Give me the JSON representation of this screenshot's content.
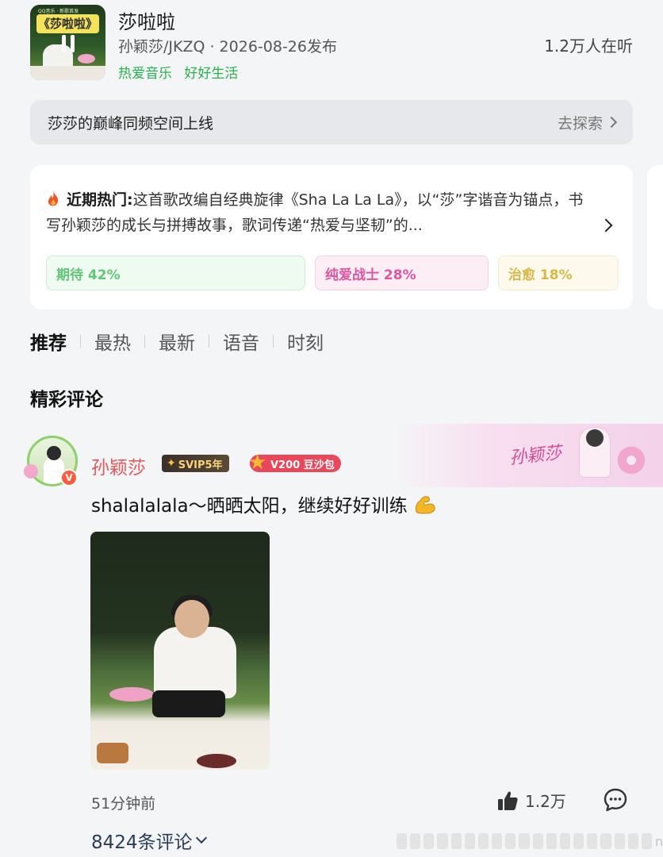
{
  "song": {
    "cover_title": "《莎啦啦》",
    "cover_tag": "QQ音乐 · 新歌首发",
    "title": "莎啦啦",
    "meta": "孙颖莎/JKZQ · 2026-08-26发布",
    "tags": [
      "热爱音乐",
      "好好生活"
    ],
    "listeners": "1.2万人在听"
  },
  "banner": {
    "text": "莎莎的巅峰同频空间上线",
    "link": "去探索"
  },
  "hot": {
    "label": "近期热门:",
    "text": "这首歌改编自经典旋律《Sha La La La》，以“莎”字谐音为锚点，书写孙颖莎的成长与拼搏故事，歌词传递“热爱与坚韧”的...",
    "chips": [
      {
        "label": "期待 42%",
        "color": "#63c57a"
      },
      {
        "label": "纯爱战士 28%",
        "color": "#e0559d"
      },
      {
        "label": "治愈 18%",
        "color": "#d9b84a"
      }
    ]
  },
  "tabs": [
    "推荐",
    "最热",
    "最新",
    "语音",
    "时刻"
  ],
  "section_title": "精彩评论",
  "comment": {
    "bg_name": "孙颖莎",
    "author": "孙颖莎",
    "svip": "SVIP5年",
    "level": "V200 豆沙包",
    "vip_mark": "V",
    "text": "shalalalala～晒晒太阳，继续好好训练",
    "time": "51分钟前",
    "likes": "1.2万",
    "count": "8424条评论"
  },
  "watermark": "n"
}
